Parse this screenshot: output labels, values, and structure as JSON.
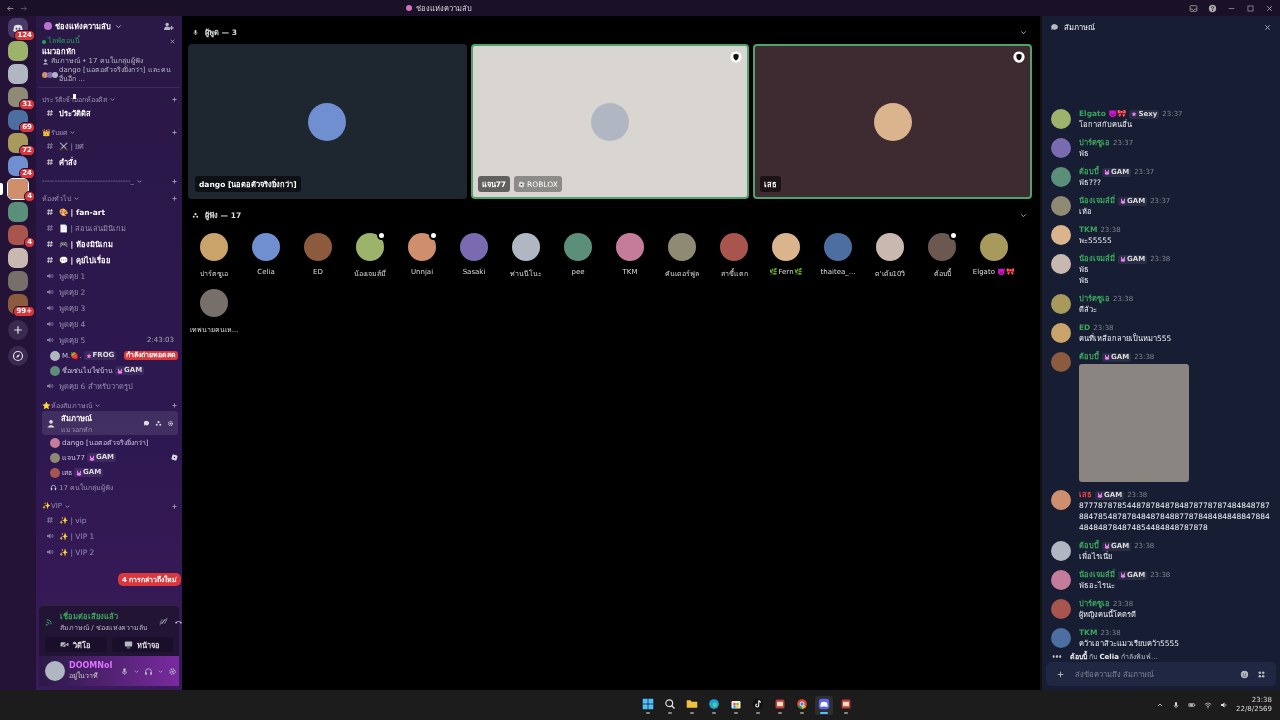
{
  "window": {
    "title": "ช่องแห่งความลับ"
  },
  "server_rail": {
    "servers": [
      {
        "kind": "home",
        "badge": "124",
        "selected": false
      },
      {
        "kind": "server",
        "selected": false
      },
      {
        "kind": "server",
        "selected": false
      },
      {
        "kind": "server",
        "badge": "31",
        "selected": false
      },
      {
        "kind": "server",
        "badge": "69",
        "selected": false
      },
      {
        "kind": "server",
        "badge": "72",
        "selected": false
      },
      {
        "kind": "server",
        "badge": "24",
        "selected": false
      },
      {
        "kind": "server",
        "badge": "4",
        "selected": true
      },
      {
        "kind": "server",
        "selected": false
      },
      {
        "kind": "server",
        "badge": "4",
        "selected": false
      },
      {
        "kind": "server",
        "selected": false
      },
      {
        "kind": "server",
        "selected": false
      },
      {
        "kind": "server",
        "badge": "99+",
        "selected": false
      },
      {
        "kind": "add",
        "selected": false
      },
      {
        "kind": "discover",
        "selected": false
      }
    ]
  },
  "sidebar": {
    "server_name": "ช่องแห่งความลับ",
    "event": {
      "status": "ไลฟ์ตอนนี้",
      "title": "แมวอกหัก",
      "meta": "สัมภาษณ์ • 17 คนในกลุ่มผู้ฟัง",
      "participants": "dango [นอตอตัวจริงยิ่งกว่า] และคนอื่นอีก ..."
    },
    "categories": [
      {
        "name": "ประวัติเข้าออกห้องดิส",
        "channels": [
          {
            "kind": "text",
            "name": "ประวัติดิส",
            "unread": true,
            "selected": false
          }
        ]
      },
      {
        "name": "👑รับยศ",
        "channels": [
          {
            "kind": "text",
            "name": "⚔️ | ยศ",
            "unread": false,
            "selected": false
          },
          {
            "kind": "text",
            "name": "คำสั่ง",
            "unread": true,
            "selected": false
          }
        ]
      },
      {
        "name": "-----------------------------------_"
      },
      {
        "name": "ห้องทั่วไป",
        "channels": [
          {
            "kind": "text",
            "name": "🎨 | fan-art",
            "unread": true,
            "selected": false
          },
          {
            "kind": "text",
            "name": "📄 | สอนเล่นมินิเกม",
            "unread": false,
            "selected": false
          },
          {
            "kind": "text",
            "name": "🎮 | ห้องมินิเกม",
            "unread": true,
            "selected": false
          },
          {
            "kind": "text",
            "name": "💬 | คุยไปเรื่อย",
            "unread": true,
            "selected": false
          },
          {
            "kind": "voice",
            "name": "พูดคุย 1",
            "unread": false,
            "selected": false
          },
          {
            "kind": "voice",
            "name": "พูดคุย 2",
            "unread": false,
            "selected": false
          },
          {
            "kind": "voice",
            "name": "พูดคุย 3",
            "unread": false,
            "selected": false
          },
          {
            "kind": "voice",
            "name": "พูดคุย 4",
            "unread": false,
            "selected": false
          },
          {
            "kind": "voice",
            "name": "พูดคุย 5",
            "unread": false,
            "selected": false,
            "timer": "2:43:03",
            "members": [
              {
                "kind": "user",
                "name": "M.🍓.",
                "tag": "FROG",
                "live_badge": "กำลังถ่ายทอดสด",
                "playing": false
              },
              {
                "kind": "user",
                "name": "ชื่อเซ่นไม่ใช่บ้าน",
                "tag": "GAM",
                "playing": false
              }
            ]
          },
          {
            "kind": "voice",
            "name": "พูดคุย 6 สำหรับวาดรูป",
            "unread": false,
            "selected": false
          }
        ]
      },
      {
        "name": "⭐ห้องสัมภาษณ์",
        "channels": [
          {
            "kind": "stage",
            "name": "สัมภาษณ์",
            "subtitle": "แมวอกหัก",
            "unread": true,
            "selected": true,
            "members": [
              {
                "kind": "user",
                "name": "dango [นอตอตัวจริงยิ่งกว่า]",
                "playing": false
              },
              {
                "kind": "user",
                "name": "แจน77",
                "tag": "GAM",
                "playing": true
              },
              {
                "kind": "user",
                "name": "เสธ",
                "tag": "GAM",
                "playing": false
              },
              {
                "kind": "audience",
                "name": "17 คนในกลุ่มผู้ฟัง"
              }
            ]
          }
        ]
      },
      {
        "name": "✨VIP",
        "channels": [
          {
            "kind": "text",
            "name": "✨ | vip",
            "unread": false,
            "selected": false
          },
          {
            "kind": "voice",
            "name": "✨ | VIP 1",
            "unread": false,
            "selected": false
          },
          {
            "kind": "voice",
            "name": "✨ | VIP 2",
            "unread": false,
            "selected": false
          }
        ]
      }
    ],
    "mention_pill": "4 การกล่าวถึงใหม่",
    "voice_panel": {
      "status": "เชื่อมต่อเสียงแล้ว",
      "location": "สัมภาษณ์ / ช่องแห่งความลับ",
      "buttons": [
        {
          "kind": "video",
          "label": "วิดีโอ"
        },
        {
          "kind": "screen",
          "label": "หน้าจอ"
        }
      ]
    },
    "user_panel": {
      "name": "DOOMNoI",
      "status": "อยู่ในวาที"
    }
  },
  "stage": {
    "speakers_label": "ผู้พูด — 3",
    "speakers": [
      {
        "name": "dango [นอตอตัวจริงยิ่งกว่า]",
        "speaking": false,
        "moderator": false,
        "color": "#1e262f"
      },
      {
        "name": "แจน77",
        "activity": "ROBLOX",
        "speaking": true,
        "moderator": true,
        "color": "#d9d6d1"
      },
      {
        "name": "เสธ",
        "speaking": true,
        "moderator": true,
        "color": "#3e2b31"
      }
    ],
    "listeners_label": "ผู้ฟัง — 17",
    "listeners": [
      {
        "name": "ปาร์ตซูเอ",
        "badge": false
      },
      {
        "name": "Celia",
        "badge": false
      },
      {
        "name": "ED",
        "badge": false
      },
      {
        "name": "น้องเจมส์มี่",
        "badge": true
      },
      {
        "name": "Unnjai",
        "badge": true
      },
      {
        "name": "Sasaki",
        "badge": false
      },
      {
        "name": "ท่านนีโนะ",
        "badge": false
      },
      {
        "name": "pee",
        "badge": false
      },
      {
        "name": "TKM",
        "badge": false
      },
      {
        "name": "คันเดอร์ฟูล",
        "badge": false
      },
      {
        "name": "สาขี้แตก",
        "badge": false
      },
      {
        "name": "🌿Fern🌿",
        "badge": false
      },
      {
        "name": "thaitea_...",
        "badge": false
      },
      {
        "name": "ด'เด้ย10วิ",
        "badge": false
      },
      {
        "name": "ต้อบบี้",
        "badge": true
      },
      {
        "name": "Elgato 👿🎀",
        "badge": false
      },
      {
        "name": "เทพนายคนเห...",
        "badge": false
      }
    ]
  },
  "chat": {
    "title": "สัมภาษณ์",
    "messages": [
      {
        "kind": "text",
        "author": "Elgato 👿🎀",
        "color": "#3ba55c",
        "tags": [
          "Sexy"
        ],
        "time": "23:37",
        "lines": [
          "โอกาสกับคนอื่น"
        ]
      },
      {
        "kind": "text",
        "author": "ปาร์ตซูเอ",
        "color": "#3ba55c",
        "time": "23:37",
        "lines": [
          "พัธ"
        ]
      },
      {
        "kind": "text",
        "author": "ต้อบบี้",
        "color": "#3ba55c",
        "tags": [
          "GAM"
        ],
        "time": "23:37",
        "lines": [
          "พัธ???"
        ]
      },
      {
        "kind": "text",
        "author": "น้องเจมส์มี่",
        "color": "#3ba55c",
        "tags": [
          "GAM"
        ],
        "time": "23:37",
        "lines": [
          "เห้อ"
        ]
      },
      {
        "kind": "text",
        "author": "TKM",
        "color": "#3ba55c",
        "time": "23:38",
        "lines": [
          "พะ55555"
        ]
      },
      {
        "kind": "text",
        "author": "น้องเจมส์มี่",
        "color": "#3ba55c",
        "tags": [
          "GAM"
        ],
        "time": "23:38",
        "lines": [
          "พัธ",
          "พัธ"
        ]
      },
      {
        "kind": "text",
        "author": "ปาร์ตซูเอ",
        "color": "#3ba55c",
        "time": "23:38",
        "lines": [
          "ดีล้วะ"
        ]
      },
      {
        "kind": "text",
        "author": "ED",
        "color": "#3ba55c",
        "time": "23:38",
        "lines": [
          "คนที่เหลือกลายเป็นหมา555"
        ]
      },
      {
        "kind": "image",
        "author": "ต้อบบี้",
        "color": "#3ba55c",
        "tags": [
          "GAM"
        ],
        "time": "23:38"
      },
      {
        "kind": "text",
        "author": "เสธ",
        "color": "#ed4245",
        "tags": [
          "GAM"
        ],
        "time": "23:38",
        "lines": [
          "87778787854487878487848787787874848487878847854878784848784887787848484848847884484848784874854484848787878"
        ]
      },
      {
        "kind": "text",
        "author": "ต้อบบี้",
        "color": "#3ba55c",
        "tags": [
          "GAM"
        ],
        "time": "23:38",
        "lines": [
          "เพื่อไรเนี่ย"
        ]
      },
      {
        "kind": "text",
        "author": "น้องเจมส์มี่",
        "color": "#3ba55c",
        "tags": [
          "GAM"
        ],
        "time": "23:38",
        "lines": [
          "พัธอะไรนะ"
        ]
      },
      {
        "kind": "text",
        "author": "ปาร์ตซูเอ",
        "color": "#3ba55c",
        "time": "23:38",
        "lines": [
          "ผู้หญิงคนนี้โคตรดี"
        ]
      },
      {
        "kind": "text",
        "author": "TKM",
        "color": "#3ba55c",
        "time": "23:38",
        "lines": [
          "คว้าเอาสิวะแมวเรียบคว้า5555"
        ]
      }
    ],
    "typing": "**ต้อบบี้** กับ **Celia** กำลังพิมพ์...",
    "placeholder": "ส่งข้อความถึง สัมภาษณ์"
  },
  "taskbar": {
    "apps": [
      {
        "kind": "start",
        "selected": false
      },
      {
        "kind": "search",
        "selected": false
      },
      {
        "kind": "folder",
        "selected": false
      },
      {
        "kind": "edge",
        "selected": false
      },
      {
        "kind": "store",
        "selected": false
      },
      {
        "kind": "tiktok",
        "selected": false
      },
      {
        "kind": "app",
        "selected": false
      },
      {
        "kind": "chrome",
        "selected": false
      },
      {
        "kind": "discord",
        "selected": true
      },
      {
        "kind": "app",
        "selected": false
      }
    ],
    "time": "23:38",
    "date": "22/8/2569"
  }
}
